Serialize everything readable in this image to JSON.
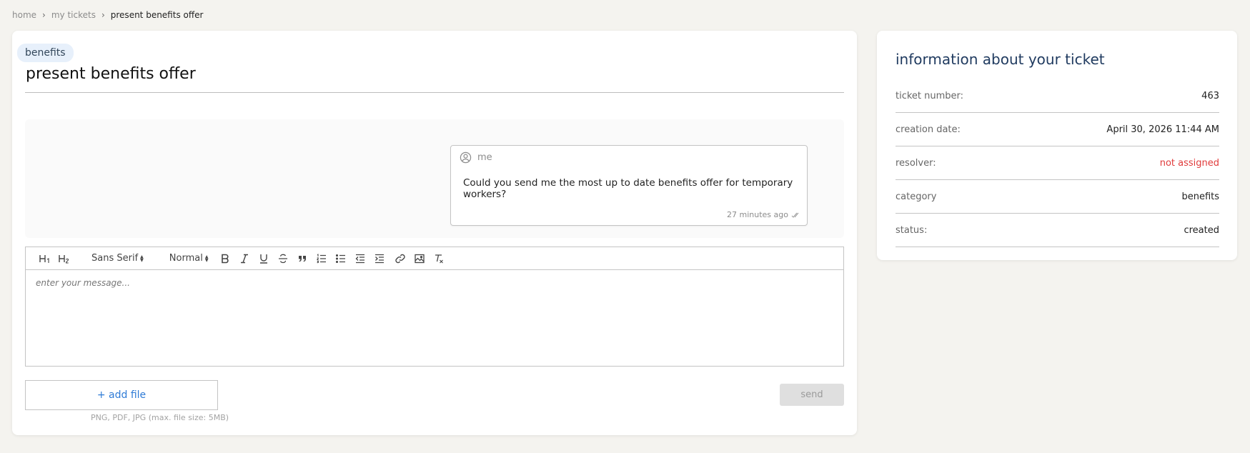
{
  "breadcrumb": {
    "home": "home",
    "tickets": "my tickets",
    "current": "present benefits offer",
    "sep": "›"
  },
  "ticket": {
    "tag": "benefits",
    "title": "present benefits offer"
  },
  "message": {
    "author": "me",
    "text": "Could you send me the most up to date benefits offer for temporary workers?",
    "time": "27 minutes ago"
  },
  "editor": {
    "font_select": "Sans Serif",
    "size_select": "Normal",
    "h1": "H1",
    "h2": "H2",
    "placeholder": "enter your message..."
  },
  "attachments": {
    "add_label": "+ add file",
    "hint": "PNG, PDF, JPG (max. file size: 5MB)"
  },
  "send_label": "send",
  "info": {
    "title": "information about your ticket",
    "rows": [
      {
        "label": "ticket number:",
        "value": "463"
      },
      {
        "label": "creation date:",
        "value": "April 30, 2026 11:44 AM"
      },
      {
        "label": "resolver:",
        "value": "not assigned"
      },
      {
        "label": "category",
        "value": "benefits"
      },
      {
        "label": "status:",
        "value": "created"
      }
    ]
  },
  "colors": {
    "accent": "#2f7bd6",
    "warning": "#e03b3b",
    "background": "#f4f3ef"
  }
}
